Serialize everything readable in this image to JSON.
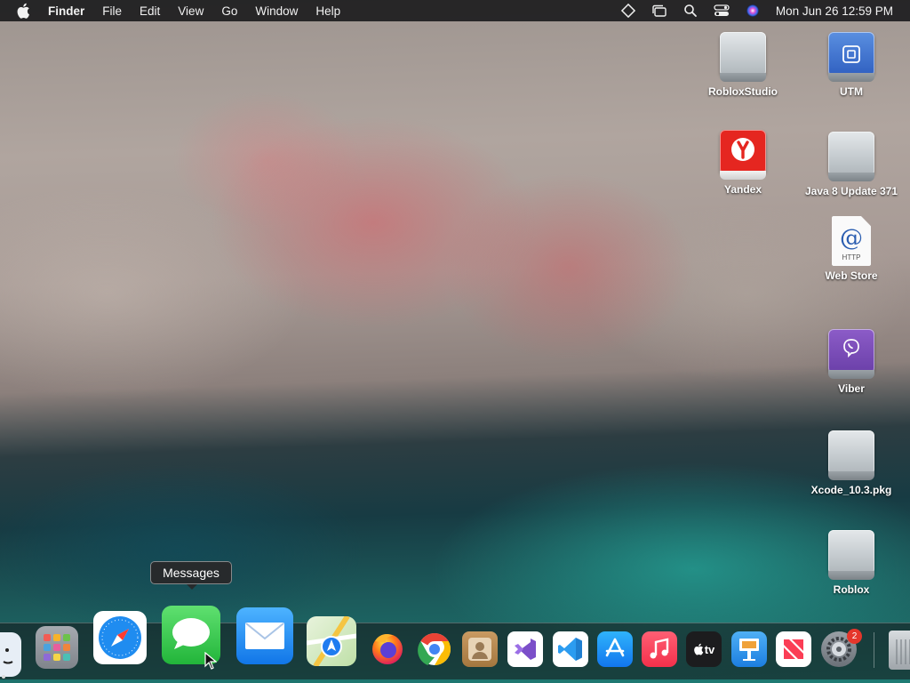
{
  "menubar": {
    "app_name": "Finder",
    "menus": [
      "File",
      "Edit",
      "View",
      "Go",
      "Window",
      "Help"
    ],
    "status_icons": [
      "diamond-icon",
      "window-stack-icon",
      "search-icon",
      "control-center-icon",
      "siri-icon"
    ],
    "clock": "Mon Jun 26  12:59 PM"
  },
  "desktop_icons": [
    {
      "label": "RobloxStudio",
      "icon": "disk-image-icon"
    },
    {
      "label": "UTM",
      "icon": "utm-disk-icon"
    },
    {
      "label": "Yandex",
      "icon": "yandex-icon"
    },
    {
      "label": "Java 8 Update 371",
      "icon": "disk-image-icon"
    },
    {
      "label": "Web Store",
      "icon": "http-location-icon"
    },
    {
      "label": "Viber",
      "icon": "viber-disk-icon"
    },
    {
      "label": "Xcode_10.3.pkg",
      "icon": "disk-image-icon"
    },
    {
      "label": "Roblox",
      "icon": "disk-image-icon"
    }
  ],
  "web_store_icon_text": {
    "symbol": "@",
    "caption": "HTTP"
  },
  "tooltip": {
    "text": "Messages"
  },
  "dock": {
    "items": [
      "Finder",
      "Launchpad",
      "Safari",
      "Messages",
      "Mail",
      "Maps",
      "Firefox",
      "Chrome",
      "Contacts",
      "Visual Studio",
      "Visual Studio Code",
      "App Store",
      "Music",
      "TV",
      "Keynote",
      "News",
      "System Settings",
      "Trash"
    ],
    "settings_badge": "2",
    "tv_label": "tv"
  },
  "colors": {
    "menubar": "#1c1c1e",
    "yandex_red": "#e52620",
    "viber_purple": "#7b519d",
    "messages_green": "#32c74c",
    "mail_blue": "#1a8cf2",
    "badge_red": "#e5362b"
  }
}
